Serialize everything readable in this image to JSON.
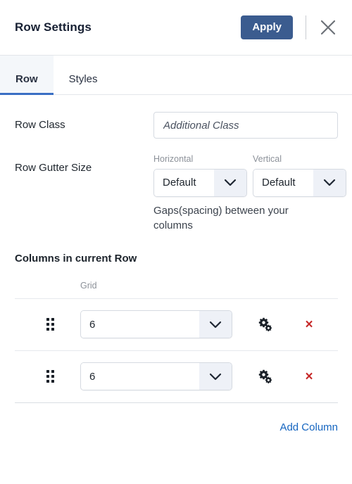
{
  "header": {
    "title": "Row Settings",
    "apply_label": "Apply",
    "close_icon": "close-icon"
  },
  "tabs": [
    {
      "label": "Row",
      "active": true
    },
    {
      "label": "Styles",
      "active": false
    }
  ],
  "form": {
    "row_class": {
      "label": "Row Class",
      "value": "",
      "placeholder": "Additional Class"
    },
    "gutter": {
      "label": "Row Gutter Size",
      "horizontal": {
        "label": "Horizontal",
        "value": "Default"
      },
      "vertical": {
        "label": "Vertical",
        "value": "Default"
      },
      "helper": "Gaps(spacing) between your columns"
    }
  },
  "columns_section": {
    "heading": "Columns in current Row",
    "grid_header": "Grid",
    "items": [
      {
        "grid": "6",
        "settings_icon": "gears-icon",
        "delete_icon": "close-icon",
        "delete_glyph": "×"
      },
      {
        "grid": "6",
        "settings_icon": "gears-icon",
        "delete_icon": "close-icon",
        "delete_glyph": "×"
      }
    ],
    "add_column_label": "Add Column"
  },
  "colors": {
    "accent": "#3b5c8f",
    "tab_underline": "#3a6fc4",
    "link": "#1565c0",
    "delete": "#c62828"
  }
}
